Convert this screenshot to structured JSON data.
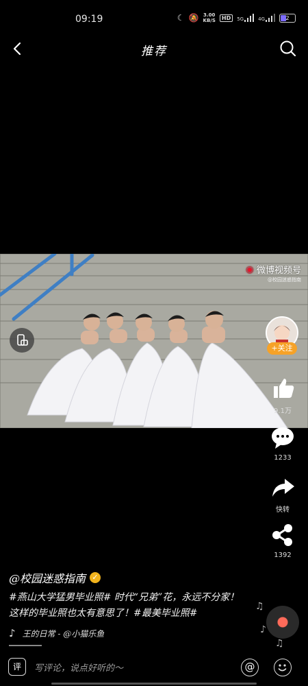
{
  "status_bar": {
    "time": "09:19",
    "speed": "3.00",
    "speed_unit": "KB/S",
    "hd": "HD",
    "network_5g": "5G",
    "network_4g": "4G",
    "battery": "2"
  },
  "nav": {
    "title": "推荐"
  },
  "video": {
    "watermark_main": "微博视频号",
    "watermark_sub": "@校园迷惑指南"
  },
  "follow_label": "+关注",
  "actions": {
    "like_count": "9.1万",
    "comment_count": "1233",
    "forward_label": "快转",
    "share_count": "1392"
  },
  "post": {
    "author": "@校园迷惑指南",
    "caption": "#燕山大学猛男毕业照# 时代“兄弟”花，永远不分家！这样的毕业照也太有意思了！#最美毕业照#",
    "music": "王的日常 - @小猫乐鱼"
  },
  "bottom_bar": {
    "comment_icon_label": "评",
    "comment_placeholder": "写评论，说点好听的～"
  },
  "colors": {
    "accent_orange": "#f6a227",
    "badge_gold": "#f2b31c",
    "background": "#000000"
  }
}
